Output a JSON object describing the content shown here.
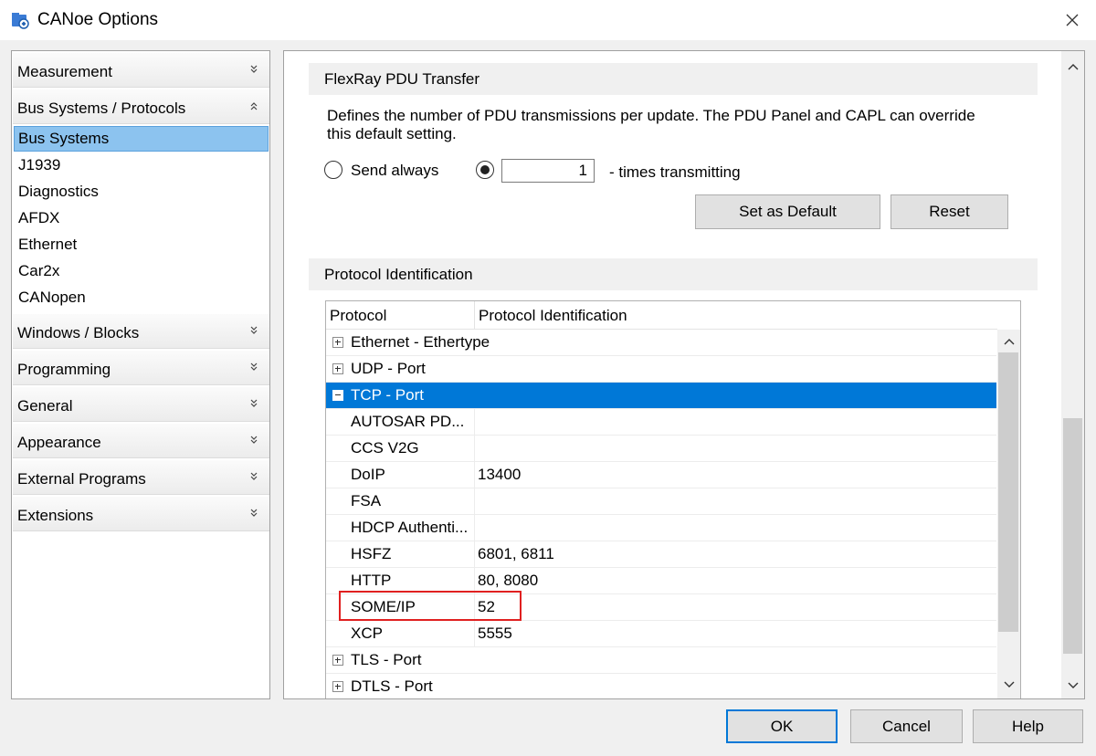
{
  "window": {
    "title": "CANoe Options"
  },
  "nav": {
    "top_sections": [
      {
        "label": "Measurement"
      },
      {
        "label": "Bus Systems / Protocols"
      }
    ],
    "items": [
      {
        "label": "Bus Systems",
        "selected": true
      },
      {
        "label": "J1939"
      },
      {
        "label": "Diagnostics"
      },
      {
        "label": "AFDX"
      },
      {
        "label": "Ethernet"
      },
      {
        "label": "Car2x"
      },
      {
        "label": "CANopen"
      }
    ],
    "bottom_sections": [
      {
        "label": "Windows / Blocks"
      },
      {
        "label": "Programming"
      },
      {
        "label": "General"
      },
      {
        "label": "Appearance"
      },
      {
        "label": "External Programs"
      },
      {
        "label": "Extensions"
      }
    ]
  },
  "pdu": {
    "header": "FlexRay PDU Transfer",
    "description": "Defines the number of PDU transmissions per update. The PDU Panel and CAPL can override this default setting.",
    "send_always_label": "Send always",
    "times_value": "1",
    "times_label": "- times transmitting",
    "set_default_label": "Set as Default",
    "reset_label": "Reset"
  },
  "protocol": {
    "header": "Protocol Identification",
    "col_protocol": "Protocol",
    "col_identification": "Protocol Identification",
    "groups": [
      {
        "name": "Ethernet - Ethertype",
        "expanded": false
      },
      {
        "name": "UDP - Port",
        "expanded": false
      },
      {
        "name": "TCP - Port",
        "expanded": true,
        "selected": true
      }
    ],
    "tcp_children": [
      {
        "name": "AUTOSAR PD...",
        "value": ""
      },
      {
        "name": "CCS V2G",
        "value": ""
      },
      {
        "name": "DoIP",
        "value": "13400"
      },
      {
        "name": "FSA",
        "value": ""
      },
      {
        "name": "HDCP Authenti...",
        "value": ""
      },
      {
        "name": "HSFZ",
        "value": "6801, 6811"
      },
      {
        "name": "HTTP",
        "value": "80, 8080"
      },
      {
        "name": "SOME/IP",
        "value": "52",
        "highlighted": true
      },
      {
        "name": "XCP",
        "value": "5555"
      }
    ],
    "trailing_groups": [
      {
        "name": "TLS - Port",
        "expanded": false
      },
      {
        "name": "DTLS - Port",
        "expanded": false
      }
    ]
  },
  "footer": {
    "ok_label": "OK",
    "cancel_label": "Cancel",
    "help_label": "Help"
  },
  "colors": {
    "selection": "#0078d7",
    "nav_selection": "#8cc3ef",
    "highlight_border": "#e02020"
  }
}
